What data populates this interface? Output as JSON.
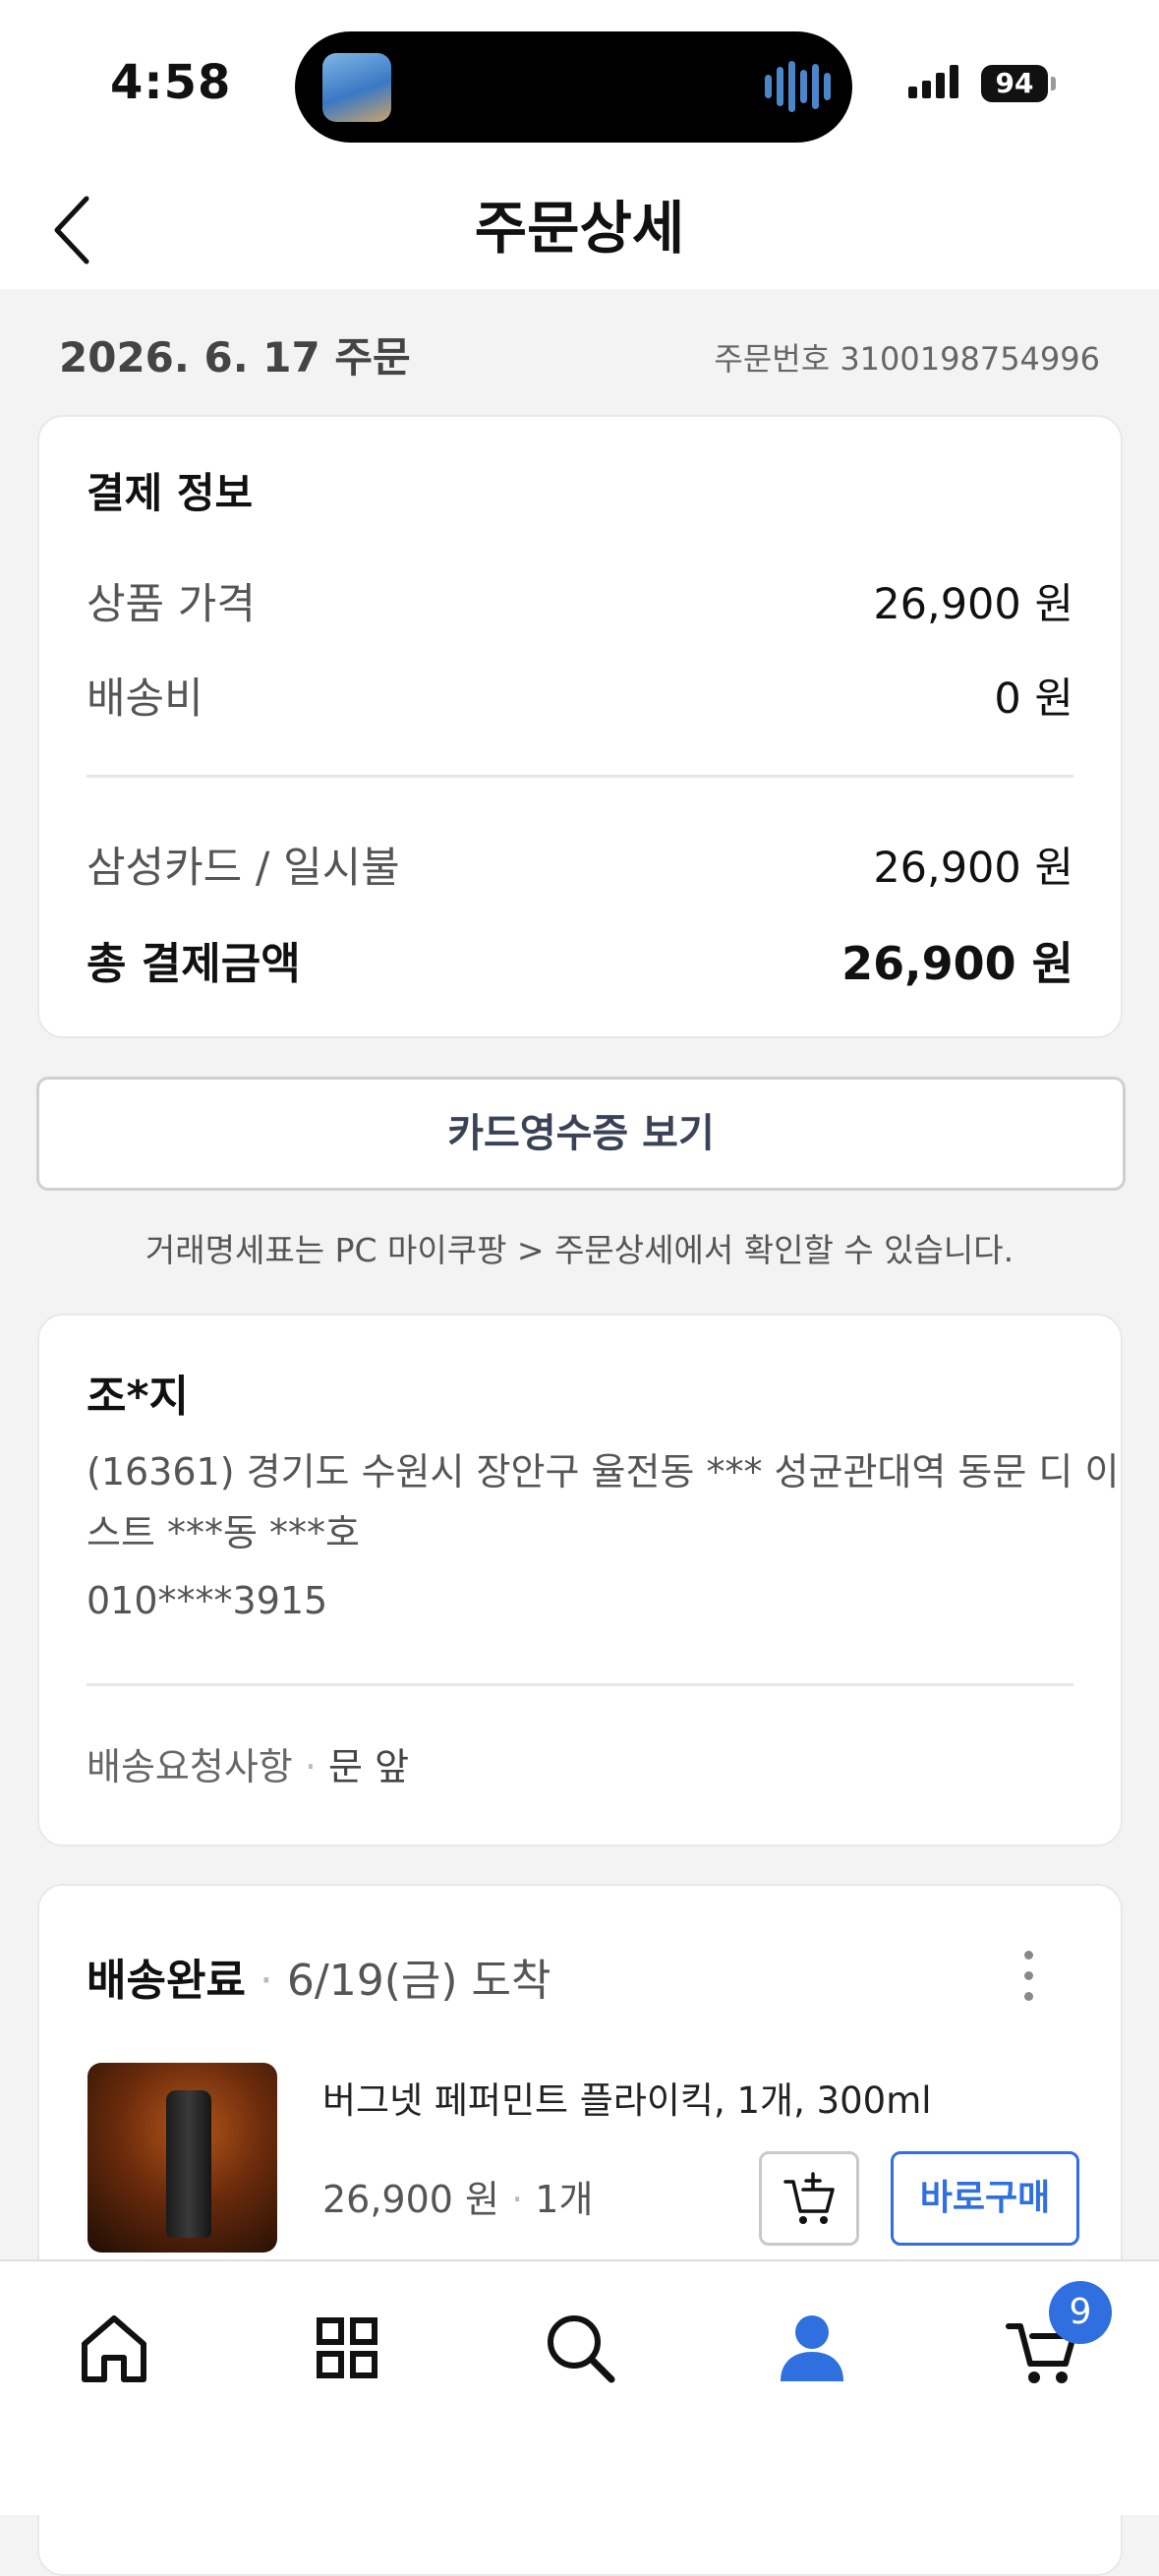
{
  "status_bar": {
    "time": "4:58",
    "battery": "94"
  },
  "header": {
    "title": "주문상세"
  },
  "order": {
    "date": "2026. 6. 17 주문",
    "number": "주문번호 3100198754996"
  },
  "payment": {
    "title": "결제 정보",
    "rows": [
      {
        "label": "상품 가격",
        "value": "26,900 원"
      },
      {
        "label": "배송비",
        "value": "0 원"
      }
    ],
    "card_label": "삼성카드 / 일시불",
    "card_value": "26,900 원",
    "total_label": "총 결제금액",
    "total_value": "26,900 원"
  },
  "receipt_button": "카드영수증 보기",
  "receipt_notice": "거래명세표는 PC 마이쿠팡 > 주문상세에서 확인할 수 있습니다.",
  "address": {
    "name": "조*지",
    "line1": "(16361) 경기도 수원시 장안구 율전동 *** 성균관대역 동문 디 이",
    "line2": "스트 ***동 ***호",
    "phone": "010****3915",
    "request_label": "배송요청사항",
    "request_sep": "·",
    "request_value": "문 앞"
  },
  "shipment": {
    "status": "배송완료",
    "sep": "·",
    "arrival": "6/19(금) 도착",
    "product_name": "버그넷 페퍼민트 플라이킥, 1개, 300ml",
    "price": "26,900 원",
    "qty": "1개",
    "buy_button": "바로구매"
  },
  "tabbar": {
    "cart_count": "9"
  },
  "colors": {
    "accent": "#2f6fe0",
    "background": "#f3f3f3"
  }
}
